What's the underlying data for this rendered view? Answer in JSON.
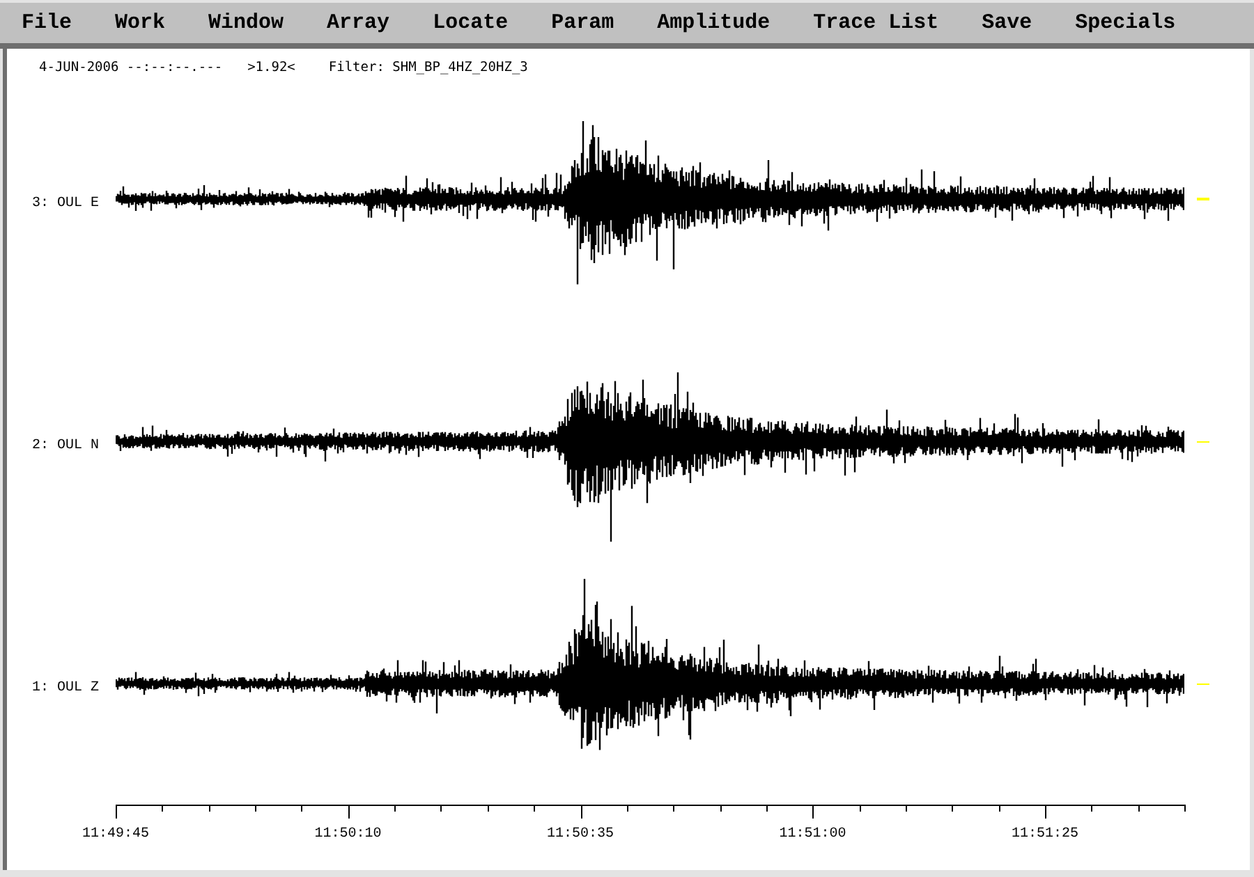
{
  "menu": [
    "File",
    "Work",
    "Window",
    "Array",
    "Locate",
    "Param",
    "Amplitude",
    "Trace List",
    "Save",
    "Specials"
  ],
  "header": {
    "date_time": "4-JUN-2006 --:--:--.---",
    "scale": ">1.92<",
    "filter": "Filter: SHM_BP_4HZ_20HZ_3"
  },
  "traces": [
    {
      "label": "3: OUL E",
      "selected": true
    },
    {
      "label": "2: OUL N",
      "selected": false
    },
    {
      "label": "1: OUL Z",
      "selected": false
    }
  ],
  "time_axis": {
    "labels": [
      "11:49:45",
      "11:50:10",
      "11:50:35",
      "11:51:00",
      "11:51:25"
    ]
  }
}
